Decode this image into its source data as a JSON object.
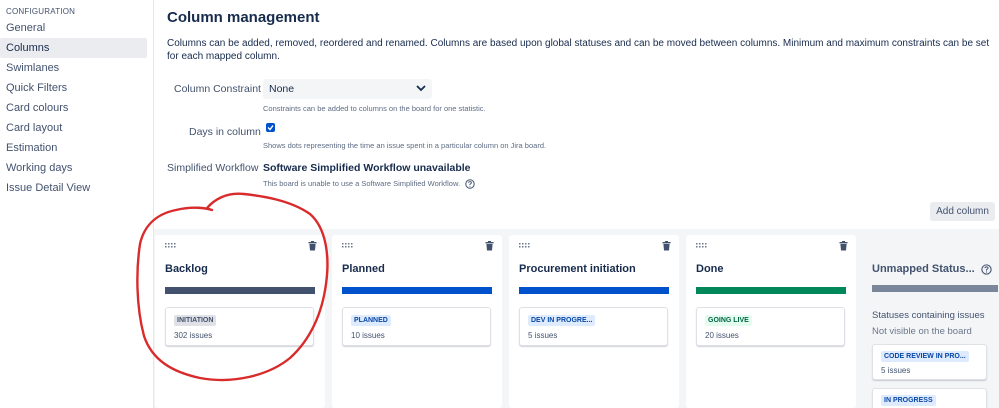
{
  "sidebar": {
    "heading": "CONFIGURATION",
    "items": [
      {
        "label": "General",
        "active": false
      },
      {
        "label": "Columns",
        "active": true
      },
      {
        "label": "Swimlanes",
        "active": false
      },
      {
        "label": "Quick Filters",
        "active": false
      },
      {
        "label": "Card colours",
        "active": false
      },
      {
        "label": "Card layout",
        "active": false
      },
      {
        "label": "Estimation",
        "active": false
      },
      {
        "label": "Working days",
        "active": false
      },
      {
        "label": "Issue Detail View",
        "active": false
      }
    ]
  },
  "main": {
    "title": "Column management",
    "description": "Columns can be added, removed, reordered and renamed. Columns are based upon global statuses and can be moved between columns. Minimum and maximum constraints can be set for each mapped column.",
    "constraint": {
      "label": "Column Constraint",
      "value": "None",
      "help": "Constraints can be added to columns on the board for one statistic."
    },
    "days_in_column": {
      "label": "Days in column",
      "checked": true,
      "help": "Shows dots representing the time an issue spent in a particular column on Jira board."
    },
    "workflow": {
      "label": "Simplified Workflow",
      "value": "Software Simplified Workflow unavailable",
      "help": "This board is unable to use a Software Simplified Workflow."
    },
    "add_column_label": "Add column"
  },
  "columns": [
    {
      "title": "Backlog",
      "bar_color": "#42526e",
      "status": "INITIATION",
      "status_style": "grey",
      "count": "302 issues"
    },
    {
      "title": "Planned",
      "bar_color": "#0052cc",
      "status": "PLANNED",
      "status_style": "blue",
      "count": "10 issues"
    },
    {
      "title": "Procurement initiation",
      "bar_color": "#0052cc",
      "status": "DEV IN PROGRE...",
      "status_style": "blue",
      "count": "5 issues"
    },
    {
      "title": "Done",
      "bar_color": "#00875a",
      "status": "GOING LIVE",
      "status_style": "green",
      "count": "20 issues"
    }
  ],
  "unmapped": {
    "title": "Unmapped Status...",
    "subtitle": "Statuses containing issues",
    "note": "Not visible on the board",
    "cards": [
      {
        "status": "CODE REVIEW IN PRO...",
        "count": "5 issues"
      },
      {
        "status": "IN PROGRESS",
        "count": ""
      }
    ]
  },
  "colors": {
    "accent": "#0052cc",
    "annotation": "#d92b2b"
  }
}
